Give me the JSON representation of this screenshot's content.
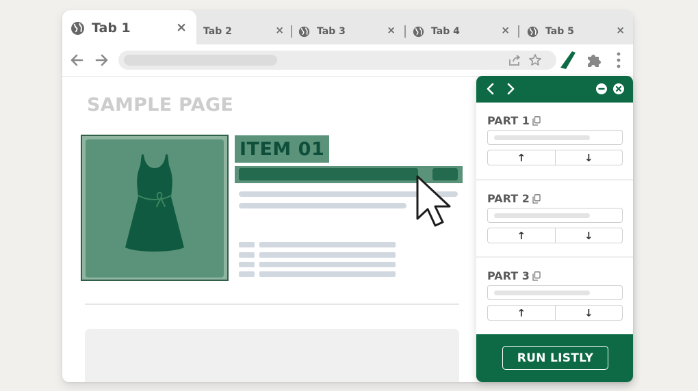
{
  "tabs": [
    {
      "label": "Tab 1",
      "close": "×",
      "active": true
    },
    {
      "label": "Tab 2",
      "close": "×",
      "active": false
    },
    {
      "label": "Tab 3",
      "close": "×",
      "active": false
    },
    {
      "label": "Tab 4",
      "close": "×",
      "active": false
    },
    {
      "label": "Tab 5",
      "close": "×",
      "active": false
    }
  ],
  "toolbar": {
    "icons": [
      "back-arrow-icon",
      "forward-arrow-icon",
      "share-icon",
      "star-icon",
      "listly-extension-icon",
      "puzzle-extensions-icon",
      "more-menu-icon"
    ]
  },
  "page": {
    "title": "SAMPLE PAGE",
    "item_title": "ITEM 01",
    "product_image": "dress-icon"
  },
  "panel": {
    "parts": [
      {
        "label": "PART 1",
        "up": "↑",
        "down": "↓"
      },
      {
        "label": "PART 2",
        "up": "↑",
        "down": "↓"
      },
      {
        "label": "PART 3",
        "up": "↑",
        "down": "↓"
      }
    ],
    "run_label": "RUN LISTLY"
  },
  "colors": {
    "brand_green": "#0d6a45",
    "highlight_green": "#5a9379",
    "dark_green": "#236a4f"
  }
}
